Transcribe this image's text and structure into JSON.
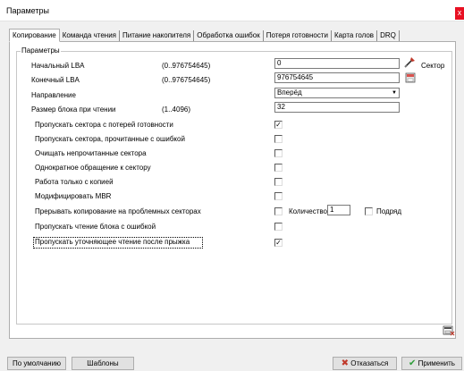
{
  "window": {
    "title": "Параметры",
    "close_glyph": "x"
  },
  "tabs": [
    {
      "label": "Копирование"
    },
    {
      "label": "Команда чтения"
    },
    {
      "label": "Питание накопителя"
    },
    {
      "label": "Обработка ошибок"
    },
    {
      "label": "Потеря готовности"
    },
    {
      "label": "Карта голов"
    },
    {
      "label": "DRQ"
    }
  ],
  "group": {
    "legend": "Параметры"
  },
  "fields": {
    "start_lba": {
      "label": "Начальный LBA",
      "range": "(0..976754645)",
      "value": "0"
    },
    "end_lba": {
      "label": "Конечный LBA",
      "range": "(0..976754645)",
      "value": "976754645"
    },
    "direction": {
      "label": "Направление",
      "value": "Вперёд"
    },
    "block_size": {
      "label": "Размер блока при чтении",
      "range": "(1..4096)",
      "value": "32"
    },
    "sector_label": "Сектор"
  },
  "options": [
    {
      "label": "Пропускать сектора с потерей готовности",
      "checked": "✓"
    },
    {
      "label": "Пропускать сектора, прочитанные с ошибкой",
      "checked": ""
    },
    {
      "label": "Очищать непрочитанные сектора",
      "checked": ""
    },
    {
      "label": "Однократное обращение к сектору",
      "checked": ""
    },
    {
      "label": "Работа только с копией",
      "checked": ""
    },
    {
      "label": "Модифицировать MBR",
      "checked": ""
    },
    {
      "label": "Прерывать копирование на проблемных секторах",
      "checked": ""
    },
    {
      "label": "Пропускать чтение блока с ошибкой",
      "checked": ""
    },
    {
      "label": "Пропускать уточняющее чтение после прыжка",
      "checked": "✓"
    }
  ],
  "interrupt_extra": {
    "count_label": "Количество",
    "count_value": "1",
    "consecutive_label": "Подряд",
    "consecutive_checked": ""
  },
  "icons": {
    "pick_icon": "pick-sector-icon",
    "end_icon": "end-lba-icon",
    "save_icon": "save-settings-icon"
  },
  "buttons": {
    "defaults": "По умолчанию",
    "templates": "Шаблоны",
    "cancel": "Отказаться",
    "apply": "Применить"
  },
  "colors": {
    "cancel_x": "#c0392b",
    "apply_check": "#2e9e3a"
  }
}
